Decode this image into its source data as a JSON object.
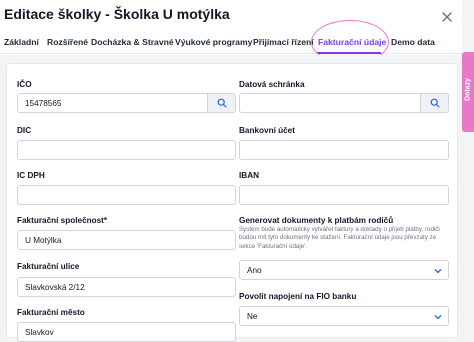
{
  "header": {
    "title": "Editace školky - Školka U motýlka"
  },
  "tabs": [
    {
      "label": "Základní"
    },
    {
      "label": "Rozšířené"
    },
    {
      "label": "Docházka & Stravné"
    },
    {
      "label": "Výukové programy"
    },
    {
      "label": "Přijímací řízení"
    },
    {
      "label": "Fakturační údaje"
    },
    {
      "label": "Demo data"
    }
  ],
  "active_tab": "Fakturační údaje",
  "sidebar_tab": {
    "label": "Dotazy"
  },
  "form": {
    "ico": {
      "label": "IČO",
      "value": "15478565"
    },
    "datova_schranka": {
      "label": "Datová schránka",
      "value": ""
    },
    "dic": {
      "label": "DIC",
      "value": ""
    },
    "bankovni_ucet": {
      "label": "Bankovní účet",
      "value": ""
    },
    "ic_dph": {
      "label": "IC DPH",
      "value": ""
    },
    "iban": {
      "label": "IBAN",
      "value": ""
    },
    "fakturacni_spolecnost": {
      "label": "Fakturační společnost*",
      "value": "U Motýlka"
    },
    "generovat": {
      "label": "Generovat dokumenty k platbám rodičů",
      "help": "Systém bude automaticky vytvářet faktury a doklady o přijetí platby, rodiči budou mít tyto dokumenty ke stažení. Fakturační údaje jsou převzaty ze sekce 'Fakturační údaje'.",
      "value": "Ano"
    },
    "fakturacni_ulice": {
      "label": "Fakturační ulice",
      "value": "Slavkovská 2/12"
    },
    "fio": {
      "label": "Povolit napojení na FIO banku",
      "value": "Ne"
    },
    "fakturacni_mesto": {
      "label": "Fakturační město",
      "value": "Slavkov"
    }
  },
  "colors": {
    "accent": "#7c3aed",
    "highlight": "#e879c9"
  }
}
